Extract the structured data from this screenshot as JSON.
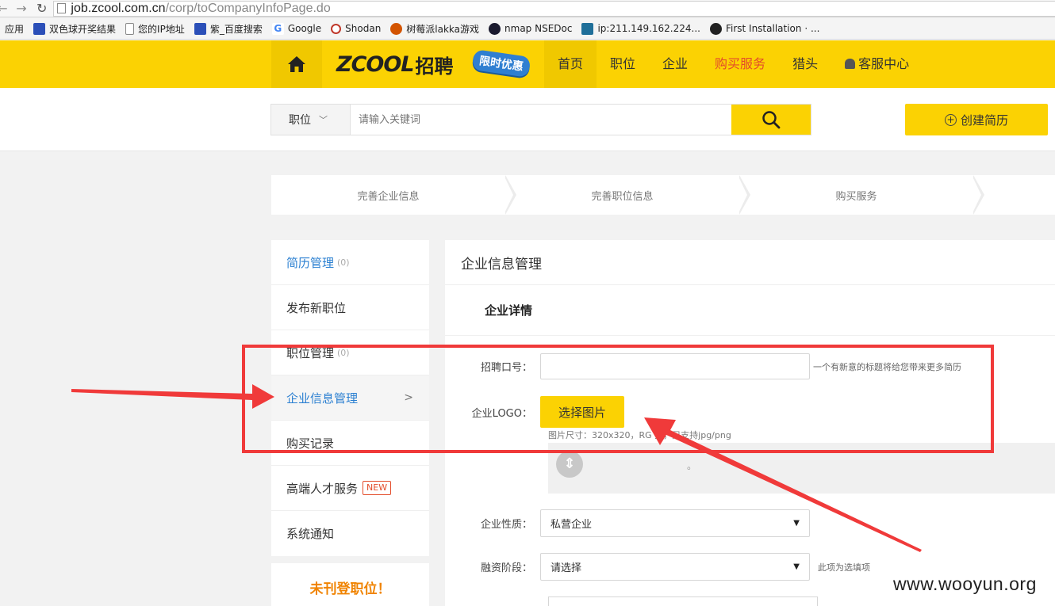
{
  "browser": {
    "url_host": "job.zcool.com.cn",
    "url_path": "/corp/toCompanyInfoPage.do",
    "bookmarks": [
      {
        "label": "应用",
        "icon": "apps-icon"
      },
      {
        "label": "双色球开奖结果",
        "icon": "baidu-paw-icon"
      },
      {
        "label": "您的IP地址",
        "icon": "page-icon"
      },
      {
        "label": "紫_百度搜索",
        "icon": "baidu-paw-icon"
      },
      {
        "label": "Google",
        "icon": "google-icon"
      },
      {
        "label": "Shodan",
        "icon": "shodan-icon"
      },
      {
        "label": "树莓派lakka游戏",
        "icon": "raspberry-icon"
      },
      {
        "label": "nmap NSEDoc",
        "icon": "eye-icon"
      },
      {
        "label": "ip:211.149.162.224...",
        "icon": "bing-icon"
      },
      {
        "label": "First Installation · ...",
        "icon": "github-icon"
      }
    ]
  },
  "header": {
    "logo_text": "ZCOOL",
    "logo_cn": "招聘",
    "promo": "限时优惠",
    "nav": [
      {
        "label": "首页",
        "active": true
      },
      {
        "label": "职位"
      },
      {
        "label": "企业"
      },
      {
        "label": "购买服务",
        "highlight": true
      },
      {
        "label": "猎头"
      },
      {
        "label": "客服中心",
        "icon": "bell-icon"
      }
    ]
  },
  "search": {
    "type_label": "职位",
    "placeholder": "请输入关键词",
    "create_label": "创建简历"
  },
  "steps": [
    "完善企业信息",
    "完善职位信息",
    "购买服务"
  ],
  "sidebar": {
    "items": [
      {
        "label": "简历管理",
        "count": "(0)"
      },
      {
        "label": "发布新职位"
      },
      {
        "label": "职位管理",
        "count": "(0)"
      },
      {
        "label": "企业信息管理"
      },
      {
        "label": "购买记录"
      },
      {
        "label": "高端人才服务",
        "badge": "NEW"
      },
      {
        "label": "系统通知"
      }
    ],
    "promo": "未刊登职位！"
  },
  "main": {
    "title": "企业信息管理",
    "subtitle": "企业详情",
    "slogan_label": "招聘口号：",
    "slogan_hint": "一个有新意的标题将给您带来更多简历",
    "logo_label": "企业LOGO：",
    "choose_image": "选择图片",
    "image_hint": "图片尺寸：320x320，RG  式，只支持jpg/png",
    "upload_dot": "。",
    "nature_label": "企业性质：",
    "nature_value": "私营企业",
    "funding_label": "融资阶段：",
    "funding_value": "请选择",
    "funding_hint": "此项为选填项"
  },
  "watermark": "www.wooyun.org",
  "colors": {
    "brand_yellow": "#fbd203",
    "link_blue": "#2a7fd1",
    "annotation_red": "#f03a3a",
    "promo_orange": "#f08300"
  }
}
